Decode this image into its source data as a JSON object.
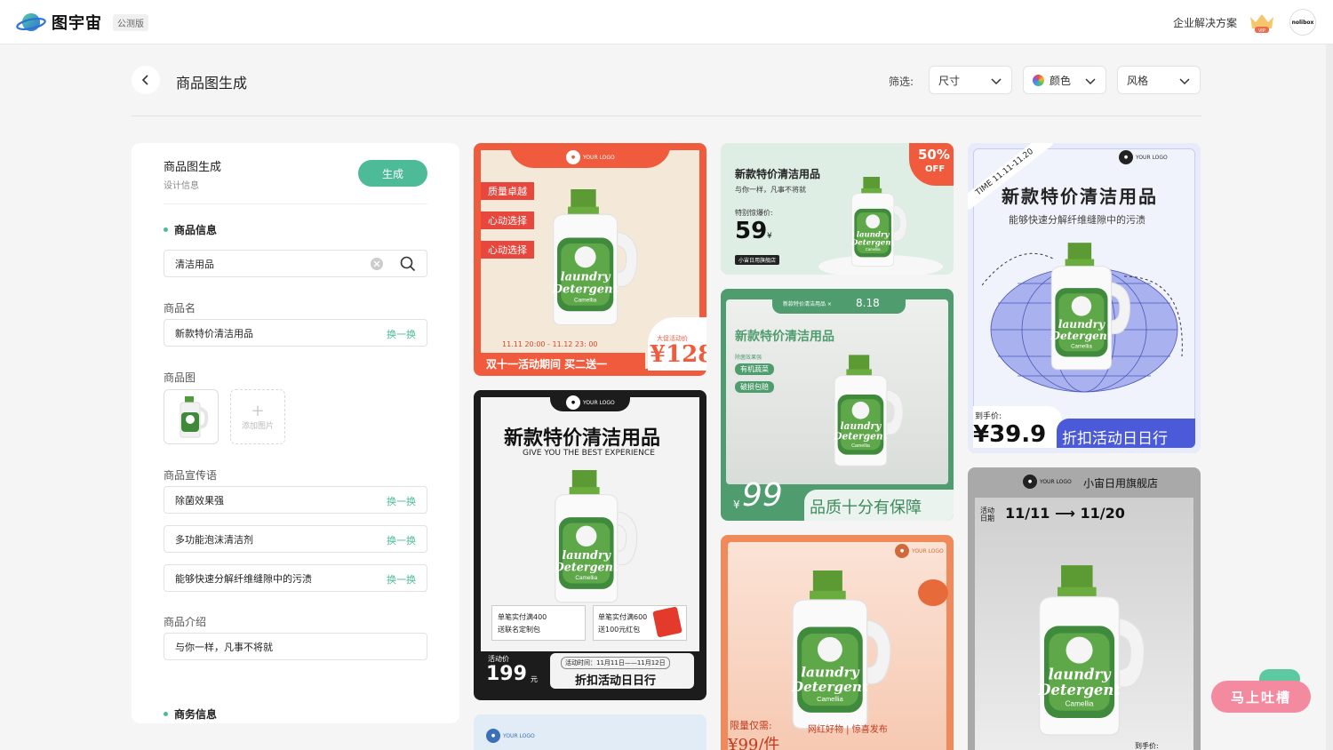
{
  "app": {
    "name": "图宇宙",
    "beta": "公测版"
  },
  "topbar": {
    "enterprise": "企业解决方案",
    "vip": "VIP",
    "avatar": "nolibox"
  },
  "header": {
    "title": "商品图生成",
    "filter_label": "筛选:",
    "filters": [
      {
        "label": "尺寸"
      },
      {
        "label": "颜色"
      },
      {
        "label": "风格"
      }
    ]
  },
  "panel": {
    "title": "商品图生成",
    "subtitle": "设计信息",
    "generate": "生成",
    "section_product": "商品信息",
    "category_value": "清洁用品",
    "name_label": "商品名",
    "name_value": "新款特价清洁用品",
    "swap": "换一换",
    "image_label": "商品图",
    "add_image": "添加图片",
    "slogan_label": "商品宣传语",
    "slogans": [
      "除菌效果强",
      "多功能泡沫清洁剂",
      "能够快速分解纤维缝隙中的污渍"
    ],
    "intro_label": "商品介绍",
    "intro_value": "与你一样，凡事不将就",
    "section_business": "商务信息"
  },
  "cards": {
    "c1": {
      "logo": "YOUR LOGO",
      "tags": [
        "质量卓越",
        "心动选择",
        "心动选择"
      ],
      "time": "11.11 20:00 - 11.12 23: 00",
      "promo": "大促活动价",
      "price": "¥128",
      "banner": "双十一活动期间 买二送一"
    },
    "c2": {
      "title": "新款特价清洁用品",
      "sub": "与你一样，凡事不将就",
      "special": "特别惊爆价:",
      "price": "59",
      "unit": "¥",
      "shop": "小宙日用旗舰店",
      "badge": "50%",
      "badge_off": "OFF"
    },
    "c3": {
      "time": "TIME 11.11-11.20",
      "logo": "YOUR LOGO",
      "title": "新款特价清洁用品",
      "sub": "能够快速分解纤维缝隙中的污渍",
      "price_label": "到手价:",
      "price": "¥39.9",
      "banner": "折扣活动日日行"
    },
    "c4": {
      "logo": "YOUR LOGO",
      "title": "新款特价清洁用品",
      "sub": "GIVE YOU THE BEST EXPERIENCE",
      "box1a": "单笔实付满400",
      "box1b": "送联名定制包",
      "box2a": "单笔实付满600",
      "box2b": "送100元红包",
      "act_label": "活动价",
      "price": "199",
      "unit": "元",
      "act_time": "活动时间：11月11日——11月12日",
      "banner": "折扣活动日日行"
    },
    "c5": {
      "top": "新款特价清洁用品 ×",
      "date": "8.18",
      "title": "新款特价清洁用品",
      "small": "除菌效果强",
      "pill1": "有机蔬菜",
      "pill2": "破损包赔",
      "price": "99",
      "unit": "¥",
      "banner": "品质十分有保障"
    },
    "c6": {
      "shop": "小宙日用旗舰店",
      "act": "活动日期",
      "dates": "11/11 ⟶ 11/20",
      "price_label": "到手价:"
    },
    "c7": {
      "logo": "YOUR LOGO"
    },
    "c8": {
      "logo": "YOUR LOGO",
      "limit": "限量仅需:",
      "price": "¥99/件",
      "tag": "网红好物 | 惊喜发布"
    }
  },
  "feedback": "马上吐槽",
  "colors": {
    "accent": "#4dbb97",
    "red": "#e7473c",
    "green": "#5aa67a"
  }
}
